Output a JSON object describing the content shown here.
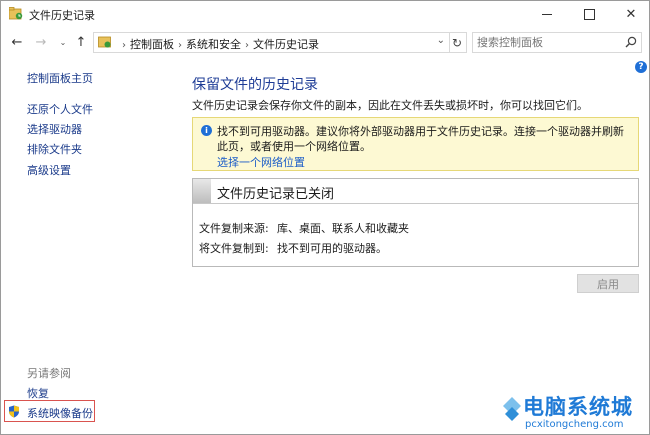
{
  "window": {
    "title": "文件历史记录",
    "controls": {
      "minimize": "minimize-icon",
      "maximize": "maximize-icon",
      "close": "✕"
    }
  },
  "navigation": {
    "back": "←",
    "forward": "→",
    "history": "⌄",
    "up": "↑",
    "breadcrumbs": [
      "控制面板",
      "系统和安全",
      "文件历史记录"
    ],
    "separator": "›",
    "address_dropdown": "⌄",
    "refresh": "↻",
    "search_placeholder": "搜索控制面板"
  },
  "help": "?",
  "sidebar": {
    "home": "控制面板主页",
    "items": [
      "还原个人文件",
      "选择驱动器",
      "排除文件夹",
      "高级设置"
    ],
    "see_also_label": "另请参阅",
    "see_also": [
      "恢复",
      "系统映像备份"
    ]
  },
  "main": {
    "title": "保留文件的历史记录",
    "description": "文件历史记录会保存你文件的副本，因此在文件丢失或损坏时，你可以找回它们。",
    "warning": {
      "message": "找不到可用驱动器。建议你将外部驱动器用于文件历史记录。连接一个驱动器并刷新此页，或者使用一个网络位置。",
      "link": "选择一个网络位置"
    },
    "status": {
      "header": "文件历史记录已关闭",
      "copy_from_label": "文件复制来源:",
      "copy_from_value": "库、桌面、联系人和收藏夹",
      "copy_to_label": "将文件复制到:",
      "copy_to_value": "找不到可用的驱动器。"
    },
    "enable_button": "启用"
  },
  "watermark": {
    "text_cn": "电脑系统城",
    "text_en": "pcxitongcheng.com"
  },
  "colors": {
    "heading_blue": "#1e3c96",
    "link_blue": "#1a3a8a",
    "warning_bg": "#fdf9d3",
    "highlight_border": "#d9534f",
    "watermark_blue": "#1f7ad6"
  }
}
